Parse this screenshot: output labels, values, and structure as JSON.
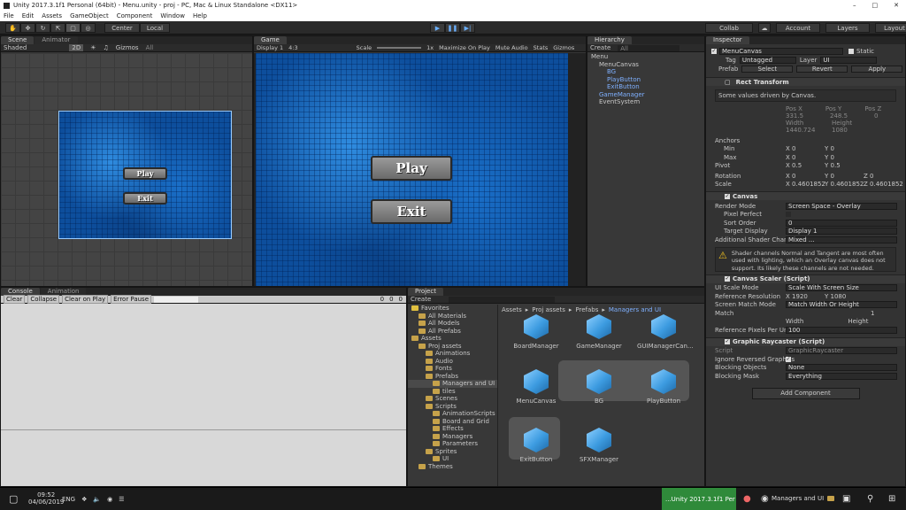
{
  "window": {
    "title": "Unity 2017.3.1f1 Personal (64bit) - Menu.unity - proj - PC, Mac & Linux Standalone <DX11>"
  },
  "menu": [
    "File",
    "Edit",
    "Assets",
    "GameObject",
    "Component",
    "Window",
    "Help"
  ],
  "toolbar": {
    "center": "Center",
    "local": "Local",
    "collab": "Collab",
    "account": "Account",
    "layers": "Layers",
    "layout": "Layout"
  },
  "scene": {
    "tab": "Scene",
    "tab2": "Animator",
    "shaded": "Shaded",
    "mode2d": "2D",
    "gizmos": "Gizmos",
    "all": "All",
    "play": "Play",
    "exit": "Exit"
  },
  "game": {
    "tab": "Game",
    "display": "Display 1",
    "aspect": "4:3",
    "scale": "Scale",
    "scale_val": "1x",
    "maximize": "Maximize On Play",
    "mute": "Mute Audio",
    "stats": "Stats",
    "gizmos": "Gizmos",
    "play": "Play",
    "exit": "Exit"
  },
  "hierarchy": {
    "tab": "Hierarchy",
    "create": "Create",
    "search": "All",
    "items": [
      {
        "label": "Menu",
        "depth": 0,
        "blue": false
      },
      {
        "label": "MenuCanvas",
        "depth": 1,
        "blue": false
      },
      {
        "label": "BG",
        "depth": 2,
        "blue": true
      },
      {
        "label": "PlayButton",
        "depth": 2,
        "blue": true
      },
      {
        "label": "ExitButton",
        "depth": 2,
        "blue": true
      },
      {
        "label": "GameManager",
        "depth": 1,
        "blue": true
      },
      {
        "label": "EventSystem",
        "depth": 1,
        "blue": false
      }
    ]
  },
  "console": {
    "tab": "Console",
    "tab2": "Animation",
    "clear": "Clear",
    "collapse": "Collapse",
    "clear_on_play": "Clear on Play",
    "error_pause": "Error Pause",
    "c1": "0",
    "c2": "0",
    "c3": "0"
  },
  "project": {
    "tab": "Project",
    "create": "Create",
    "breadcrumb": [
      "Assets",
      "Proj assets",
      "Prefabs",
      "Managers and UI"
    ],
    "tree": [
      {
        "label": "Favorites",
        "depth": 0
      },
      {
        "label": "All Materials",
        "depth": 1
      },
      {
        "label": "All Models",
        "depth": 1
      },
      {
        "label": "All Prefabs",
        "depth": 1
      },
      {
        "label": "Assets",
        "depth": 0
      },
      {
        "label": "Proj assets",
        "depth": 1
      },
      {
        "label": "Animations",
        "depth": 2
      },
      {
        "label": "Audio",
        "depth": 2
      },
      {
        "label": "Fonts",
        "depth": 2
      },
      {
        "label": "Prefabs",
        "depth": 2
      },
      {
        "label": "Managers and UI",
        "depth": 3
      },
      {
        "label": "tiles",
        "depth": 3
      },
      {
        "label": "Scenes",
        "depth": 2
      },
      {
        "label": "Scripts",
        "depth": 2
      },
      {
        "label": "AnimationScripts",
        "depth": 3
      },
      {
        "label": "Board and Grid",
        "depth": 3
      },
      {
        "label": "Effects",
        "depth": 3
      },
      {
        "label": "Managers",
        "depth": 3
      },
      {
        "label": "Parameters",
        "depth": 3
      },
      {
        "label": "Sprites",
        "depth": 2
      },
      {
        "label": "UI",
        "depth": 3
      },
      {
        "label": "Themes",
        "depth": 1
      }
    ],
    "assets": [
      "BoardManager",
      "GameManager",
      "GUIManagerCan...",
      "MenuCanvas",
      "BG",
      "PlayButton",
      "ExitButton",
      "SFXManager"
    ]
  },
  "inspector": {
    "tab": "Inspector",
    "name": "MenuCanvas",
    "static": "Static",
    "tag_label": "Tag",
    "tag": "Untagged",
    "layer_label": "Layer",
    "layer": "UI",
    "prefab": "Prefab",
    "select": "Select",
    "revert": "Revert",
    "apply": "Apply",
    "rect": "Rect Transform",
    "driven": "Some values driven by Canvas.",
    "posx_l": "Pos X",
    "posy_l": "Pos Y",
    "posz_l": "Pos Z",
    "posx": "331.5",
    "posy": "248.5",
    "posz": "0",
    "w_l": "Width",
    "h_l": "Height",
    "w": "1440.724",
    "h": "1080",
    "anchors": "Anchors",
    "min": "Min",
    "max": "Max",
    "pivot": "Pivot",
    "x0": "0",
    "y0": "0",
    "x1": "0",
    "y1": "0",
    "px": "0.5",
    "py": "0.5",
    "rotation": "Rotation",
    "rx": "0",
    "ry": "0",
    "rz": "0",
    "scale": "Scale",
    "sx": "0.4601852",
    "sy": "0.4601852",
    "sz": "0.4601852",
    "canvas": "Canvas",
    "render_mode": "Render Mode",
    "render_val": "Screen Space - Overlay",
    "pixel_perfect": "Pixel Perfect",
    "sort_order": "Sort Order",
    "sort_val": "0",
    "target_display": "Target Display",
    "target_val": "Display 1",
    "shader_ch": "Additional Shader Channel",
    "shader_val": "Mixed ...",
    "warning": "Shader channels Normal and Tangent are most often used with lighting, which an Overlay canvas does not support. Its likely these channels are not needed.",
    "scaler": "Canvas Scaler (Script)",
    "ui_scale": "UI Scale Mode",
    "ui_scale_val": "Scale With Screen Size",
    "ref_res": "Reference Resolution",
    "rr_x": "1920",
    "rr_y": "1080",
    "match_mode": "Screen Match Mode",
    "match_mode_val": "Match Width Or Height",
    "match": "Match",
    "match_val": "1",
    "width": "Width",
    "height": "Height",
    "ref_ppu": "Reference Pixels Per Unit",
    "ref_ppu_val": "100",
    "raycaster": "Graphic Raycaster (Script)",
    "script": "Script",
    "script_val": "GraphicRaycaster",
    "ignore": "Ignore Reversed Graphics",
    "blocking": "Blocking Objects",
    "blocking_val": "None",
    "mask": "Blocking Mask",
    "mask_val": "Everything",
    "add": "Add Component"
  },
  "taskbar": {
    "time": "09:52",
    "date": "04/06/2019",
    "lang": "ENG",
    "unity": "...Unity 2017.3.1f1 Per",
    "folder": "Managers and UI"
  }
}
